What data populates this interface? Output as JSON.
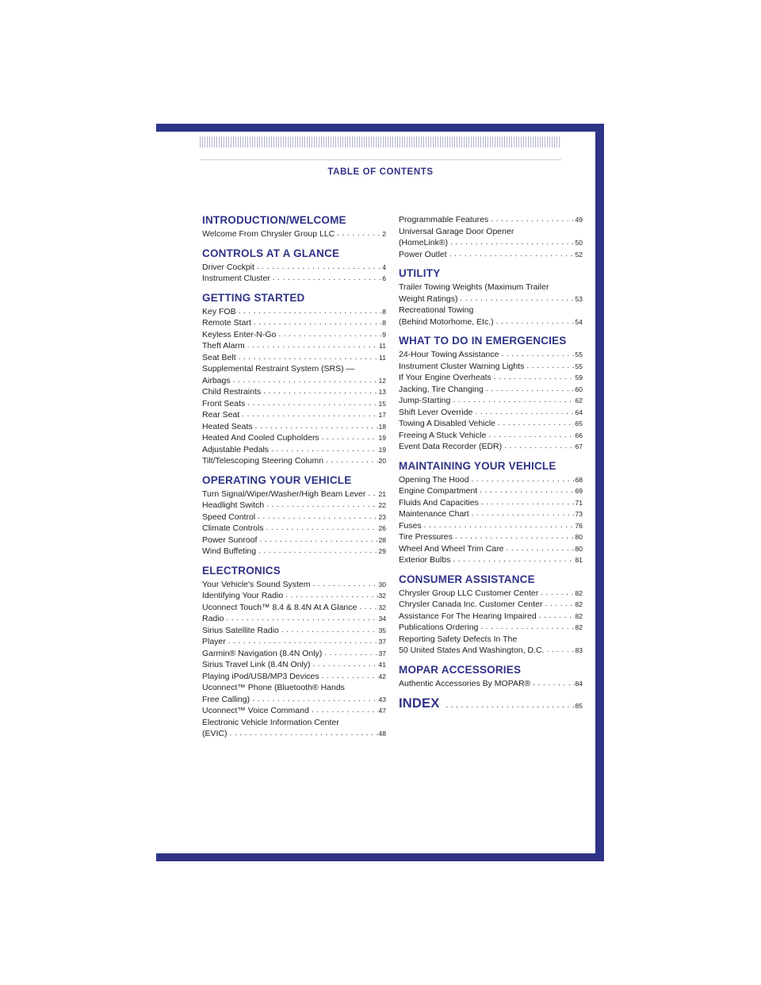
{
  "page": {
    "heading": "TABLE OF CONTENTS",
    "dot_leader": "..............................................",
    "accent_color": "#2f3387"
  },
  "left": [
    {
      "title": "INTRODUCTION/WELCOME",
      "entries": [
        {
          "text": "Welcome From Chrysler Group LLC",
          "page": "2"
        }
      ]
    },
    {
      "title": "CONTROLS AT A GLANCE",
      "entries": [
        {
          "text": "Driver Cockpit",
          "page": "4"
        },
        {
          "text": "Instrument Cluster",
          "page": "6"
        }
      ]
    },
    {
      "title": "GETTING STARTED",
      "entries": [
        {
          "text": "Key FOB",
          "page": "8"
        },
        {
          "text": "Remote Start",
          "page": "8"
        },
        {
          "text": "Keyless Enter-N-Go",
          "page": "9"
        },
        {
          "text": "Theft Alarm",
          "page": "11"
        },
        {
          "text": "Seat Belt",
          "page": "11"
        },
        {
          "text": "Supplemental Restraint System (SRS) —",
          "page": ""
        },
        {
          "text": "Airbags",
          "page": "12"
        },
        {
          "text": "Child Restraints",
          "page": "13"
        },
        {
          "text": "Front Seats",
          "page": "15"
        },
        {
          "text": "Rear Seat",
          "page": "17"
        },
        {
          "text": "Heated Seats",
          "page": "18"
        },
        {
          "text": "Heated And Cooled Cupholders",
          "page": "19"
        },
        {
          "text": "Adjustable Pedals",
          "page": "19"
        },
        {
          "text": "Tilt/Telescoping Steering Column",
          "page": "20"
        }
      ]
    },
    {
      "title": "OPERATING YOUR VEHICLE",
      "entries": [
        {
          "text": "Turn Signal/Wiper/Washer/High Beam Lever",
          "page": "21"
        },
        {
          "text": "Headlight Switch",
          "page": "22"
        },
        {
          "text": "Speed Control",
          "page": "23"
        },
        {
          "text": "Climate Controls",
          "page": "26"
        },
        {
          "text": "Power Sunroof",
          "page": "28"
        },
        {
          "text": "Wind Buffeting",
          "page": "29"
        }
      ]
    },
    {
      "title": "ELECTRONICS",
      "entries": [
        {
          "text": "Your Vehicle's Sound System",
          "page": "30"
        },
        {
          "text": "Identifying Your Radio",
          "page": "32"
        },
        {
          "text": "Uconnect Touch™ 8.4 & 8.4N At A Glance",
          "page": "32"
        },
        {
          "text": "Radio",
          "page": "34"
        },
        {
          "text": "Sirius Satellite Radio",
          "page": "35"
        },
        {
          "text": "Player",
          "page": "37"
        },
        {
          "text": "Garmin® Navigation (8.4N Only)",
          "page": "37"
        },
        {
          "text": "Sirius Travel Link (8.4N Only)",
          "page": "41"
        },
        {
          "text": "Playing iPod/USB/MP3 Devices",
          "page": "42"
        },
        {
          "text": "Uconnect™ Phone (Bluetooth® Hands",
          "page": ""
        },
        {
          "text": "Free Calling)",
          "page": "43"
        },
        {
          "text": "Uconnect™ Voice Command",
          "page": "47"
        },
        {
          "text": "Electronic Vehicle Information Center",
          "page": ""
        },
        {
          "text": "(EVIC)",
          "page": "48"
        }
      ]
    }
  ],
  "right": [
    {
      "title": "",
      "entries": [
        {
          "text": "Programmable Features",
          "page": "49"
        },
        {
          "text": "Universal Garage Door Opener",
          "page": ""
        },
        {
          "text": "(HomeLink®)",
          "page": "50"
        },
        {
          "text": "Power Outlet",
          "page": "52"
        }
      ]
    },
    {
      "title": "UTILITY",
      "entries": [
        {
          "text": "Trailer Towing Weights (Maximum Trailer",
          "page": ""
        },
        {
          "text": "Weight Ratings)",
          "page": "53"
        },
        {
          "text": "Recreational Towing",
          "page": ""
        },
        {
          "text": "(Behind Motorhome, Etc.)",
          "page": "54"
        }
      ]
    },
    {
      "title": "WHAT TO DO IN EMERGENCIES",
      "entries": [
        {
          "text": "24-Hour Towing Assistance",
          "page": "55"
        },
        {
          "text": "Instrument Cluster Warning Lights",
          "page": "55"
        },
        {
          "text": "If Your Engine Overheats",
          "page": "59"
        },
        {
          "text": "Jacking, Tire Changing",
          "page": "60"
        },
        {
          "text": "Jump-Starting",
          "page": "62"
        },
        {
          "text": "Shift Lever Override",
          "page": "64"
        },
        {
          "text": "Towing A Disabled Vehicle",
          "page": "65"
        },
        {
          "text": "Freeing A Stuck Vehicle",
          "page": "66"
        },
        {
          "text": "Event Data Recorder (EDR)",
          "page": "67"
        }
      ]
    },
    {
      "title": "MAINTAINING YOUR VEHICLE",
      "entries": [
        {
          "text": "Opening The Hood",
          "page": "68"
        },
        {
          "text": "Engine Compartment",
          "page": "69"
        },
        {
          "text": "Fluids And Capacities",
          "page": "71"
        },
        {
          "text": "Maintenance Chart",
          "page": "73"
        },
        {
          "text": "Fuses",
          "page": "76"
        },
        {
          "text": "Tire Pressures",
          "page": "80"
        },
        {
          "text": "Wheel And Wheel Trim Care",
          "page": "80"
        },
        {
          "text": "Exterior Bulbs",
          "page": "81"
        }
      ]
    },
    {
      "title": "CONSUMER ASSISTANCE",
      "entries": [
        {
          "text": "Chrysler Group LLC Customer Center",
          "page": "82"
        },
        {
          "text": "Chrysler Canada Inc. Customer Center",
          "page": "82"
        },
        {
          "text": "Assistance For The Hearing Impaired",
          "page": "82"
        },
        {
          "text": "Publications Ordering",
          "page": "82"
        },
        {
          "text": "Reporting Safety Defects In The",
          "page": ""
        },
        {
          "text": "50 United States And Washington, D.C.",
          "page": "83"
        }
      ]
    },
    {
      "title": "MOPAR ACCESSORIES",
      "entries": [
        {
          "text": "Authentic Accessories By MOPAR®",
          "page": "84"
        }
      ]
    }
  ],
  "index": {
    "title": "INDEX",
    "page": "85"
  }
}
